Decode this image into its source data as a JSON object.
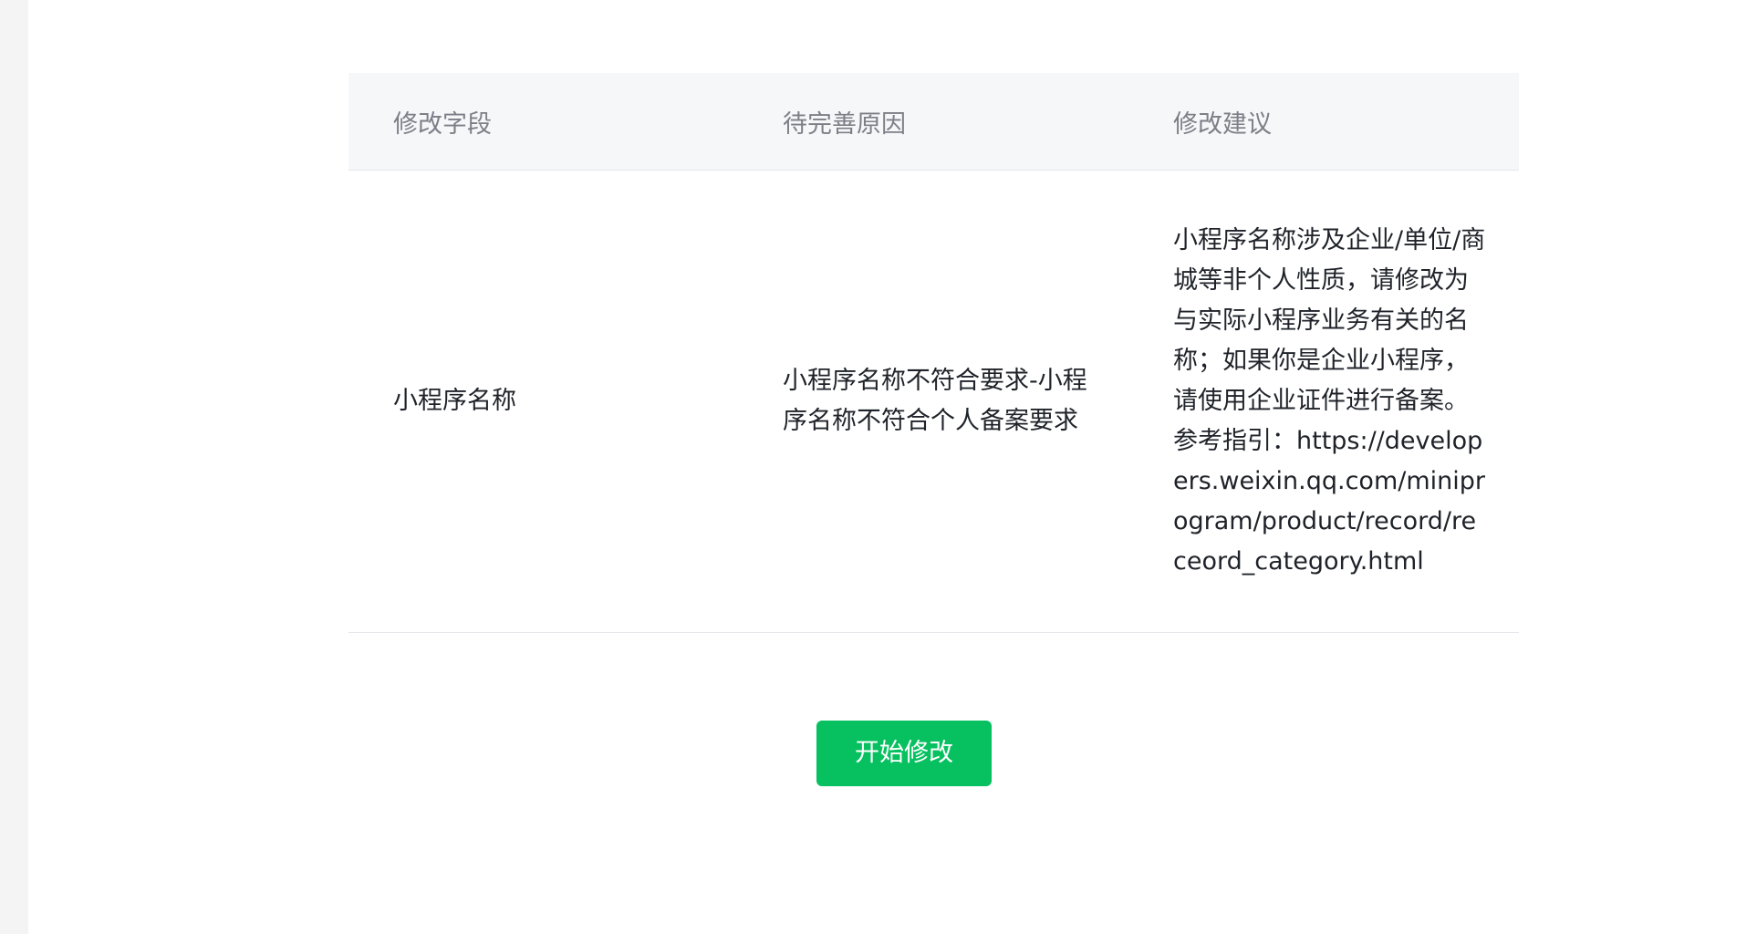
{
  "table": {
    "headers": [
      "修改字段",
      "待完善原因",
      "修改建议"
    ],
    "rows": [
      {
        "field": "小程序名称",
        "reason": "小程序名称不符合要求-小程序名称不符合个人备案要求",
        "suggestion": "小程序名称涉及企业/单位/商城等非个人性质，请修改为与实际小程序业务有关的名称；如果你是企业小程序，请使用企业证件进行备案。参考指引：https://developers.weixin.qq.com/miniprogram/product/record/receord_category.html"
      }
    ]
  },
  "actions": {
    "start_edit_label": "开始修改"
  },
  "colors": {
    "primary": "#07c160",
    "header_bg": "#f6f7f9",
    "border": "#e4e6ea",
    "header_text": "#7c7f86",
    "body_text": "#1f2329"
  }
}
